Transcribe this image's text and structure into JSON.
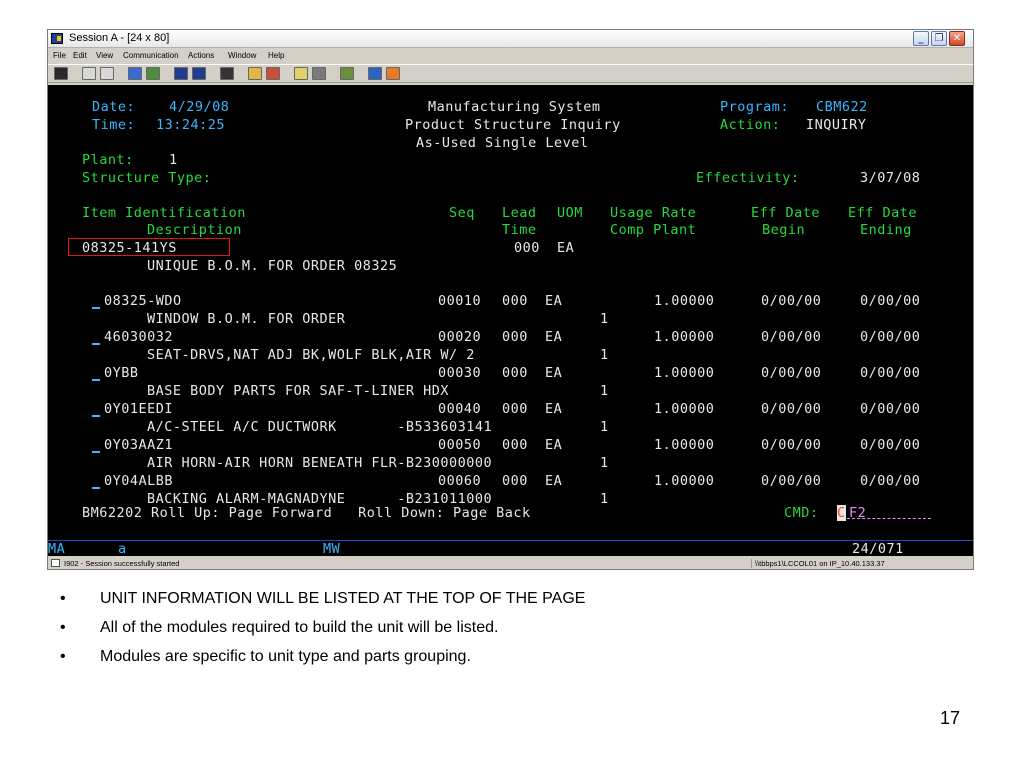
{
  "window": {
    "title": "Session A - [24 x 80]",
    "min_glyph": "_",
    "max_glyph": "❐",
    "close_glyph": "✕"
  },
  "menu": [
    "File",
    "Edit",
    "View",
    "Communication",
    "Actions",
    "Window",
    "Help"
  ],
  "toolbar_icons": [
    "print-screen-icon",
    "copy-icon",
    "paste-icon",
    "send-icon",
    "receive-icon",
    "display-icon",
    "keypad-icon",
    "macro-icon",
    "record-icon",
    "stop-icon",
    "play-icon",
    "transfer-icon",
    "setup-icon",
    "color-icon",
    "help-icon"
  ],
  "screen": {
    "date_label": "Date:",
    "date_value": "4/29/08",
    "time_label": "Time:",
    "time_value": "13:24:25",
    "title1": "Manufacturing System",
    "title2": "Product Structure Inquiry",
    "title3": "As-Used Single Level",
    "program_label": "Program:",
    "program_value": "CBM622",
    "action_label": "Action:",
    "action_value": "INQUIRY",
    "plant_label": "Plant:",
    "plant_value": "1",
    "structure_type_label": "Structure Type:",
    "effectivity_label": "Effectivity:",
    "effectivity_value": "3/07/08",
    "headers": {
      "item_identification": "Item Identification",
      "description": "Description",
      "seq": "Seq",
      "lead": "Lead",
      "time": "Time",
      "uom": "UOM",
      "usage_rate": "Usage Rate",
      "comp_plant": "Comp Plant",
      "eff_date": "Eff Date",
      "begin": "Begin",
      "eff_date_2": "Eff Date",
      "ending": "Ending"
    },
    "parent": {
      "item": "08325-141YS",
      "lead": "000",
      "uom": "EA",
      "description": "UNIQUE B.O.M. FOR ORDER 08325"
    },
    "rows": [
      {
        "item": "08325-WDO",
        "seq": "00010",
        "lead": "000",
        "uom": "EA",
        "usage": "1.00000",
        "begin": "0/00/00",
        "end": "0/00/00",
        "description": "WINDOW B.O.M. FOR ORDER",
        "comp_plant": "1"
      },
      {
        "item": "46030032",
        "seq": "00020",
        "lead": "000",
        "uom": "EA",
        "usage": "1.00000",
        "begin": "0/00/00",
        "end": "0/00/00",
        "description": "SEAT-DRVS,NAT ADJ BK,WOLF BLK,AIR W/ 2",
        "comp_plant": "1"
      },
      {
        "item": "0YBB",
        "seq": "00030",
        "lead": "000",
        "uom": "EA",
        "usage": "1.00000",
        "begin": "0/00/00",
        "end": "0/00/00",
        "description": "BASE BODY PARTS FOR SAF-T-LINER HDX",
        "comp_plant": "1"
      },
      {
        "item": "0Y01EEDI",
        "seq": "00040",
        "lead": "000",
        "uom": "EA",
        "usage": "1.00000",
        "begin": "0/00/00",
        "end": "0/00/00",
        "description": "A/C-STEEL A/C DUCTWORK       -B533603141",
        "comp_plant": "1"
      },
      {
        "item": "0Y03AAZ1",
        "seq": "00050",
        "lead": "000",
        "uom": "EA",
        "usage": "1.00000",
        "begin": "0/00/00",
        "end": "0/00/00",
        "description": "AIR HORN-AIR HORN BENEATH FLR-B230000000",
        "comp_plant": "1"
      },
      {
        "item": "0Y04ALBB",
        "seq": "00060",
        "lead": "000",
        "uom": "EA",
        "usage": "1.00000",
        "begin": "0/00/00",
        "end": "0/00/00",
        "description": "BACKING ALARM-MAGNADYNE      -B231011000",
        "comp_plant": "1"
      }
    ],
    "footer": "BM62202 Roll Up: Page Forward   Roll Down: Page Back",
    "cmd_label": "CMD:",
    "cmd_cursor": "C",
    "cmd_value": "F2"
  },
  "oia": {
    "left": "MA",
    "mode": "a",
    "mw": "MW",
    "position": "24/071"
  },
  "statusbar": {
    "message": "I902 - Session successfully started",
    "connection": "\\\\tbbps1\\LCCOL01 on IP_10.40.133.37"
  },
  "bullets": [
    "UNIT INFORMATION WILL BE LISTED AT THE TOP OF THE PAGE",
    "All of the modules required to build the unit will be listed.",
    "Modules are specific to unit type and parts grouping."
  ],
  "bullet_glyph": "•",
  "page_number": "17",
  "colors": {
    "screen_bg": "#000000",
    "field_white": "#e8e8e8",
    "field_blue": "#38b6ff",
    "field_green": "#27d93b",
    "field_pink": "#e98bfb",
    "highlight_red": "#e01818"
  }
}
